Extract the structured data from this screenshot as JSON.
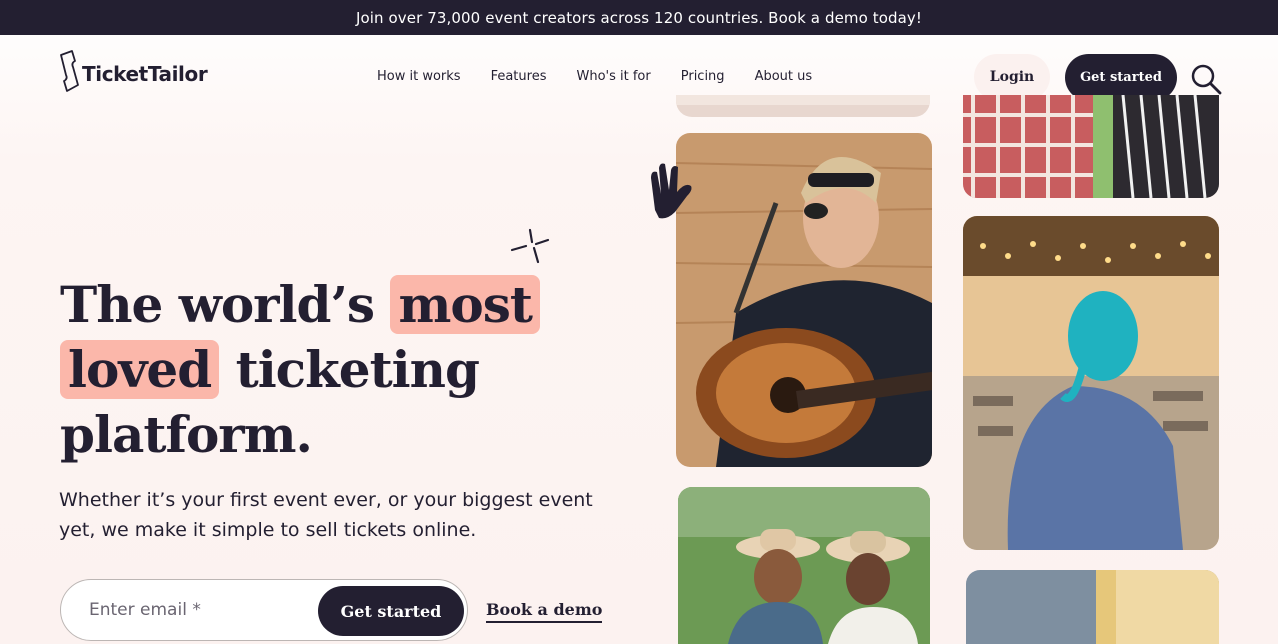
{
  "banner": {
    "text": "Join over 73,000 event creators across 120 countries. Book a demo today!"
  },
  "header": {
    "logo_text": "TicketTailor",
    "nav": [
      {
        "label": "How it works"
      },
      {
        "label": "Features"
      },
      {
        "label": "Who's it for"
      },
      {
        "label": "Pricing"
      },
      {
        "label": "About us"
      }
    ],
    "login_label": "Login",
    "get_started_label": "Get started"
  },
  "hero": {
    "title_part1": "The world’s",
    "title_hl1": "most",
    "title_hl2": "loved",
    "title_part2": "ticketing",
    "title_part3": "platform.",
    "subtitle": "Whether it’s your first event ever, or your biggest event yet, we make it simple to sell tickets online.",
    "email_placeholder": "Enter email *",
    "email_button": "Get started",
    "demo_link": "Book a demo"
  },
  "colors": {
    "dark": "#231f31",
    "highlight": "#fbb7aa",
    "background": "#fcf2f0"
  },
  "icons": [
    "ticket-logo-icon",
    "search-icon",
    "sparkle-icon",
    "hand-gesture-icon"
  ]
}
